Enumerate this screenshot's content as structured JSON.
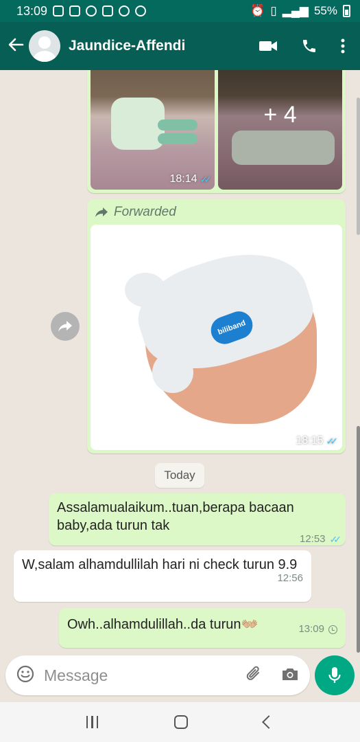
{
  "status": {
    "time": "13:09",
    "battery": "55%"
  },
  "header": {
    "contact_name": "Jaundice-Affendi",
    "back_icon": "arrow-left-icon",
    "video_icon": "video-camera-icon",
    "call_icon": "phone-icon",
    "menu_icon": "more-vert-icon"
  },
  "colors": {
    "header": "#075e54",
    "statusbar": "#056a5e",
    "outgoing": "#dcf8c6",
    "incoming": "#ffffff",
    "accent": "#00a884",
    "read_tick": "#4fc3f7"
  },
  "messages": {
    "photo_grid": {
      "more_count": "+ 4",
      "time": "18:14"
    },
    "forwarded": {
      "label": "Forwarded",
      "time": "18:15",
      "image_logo": "biliband"
    },
    "date_divider": "Today",
    "m1": {
      "text": "Assalamualaikum..tuan,berapa bacaan baby,ada turun tak",
      "time": "12:53"
    },
    "m2": {
      "text": "W,salam alhamdullilah hari ni check turun 9.9",
      "time": "12:56"
    },
    "m3": {
      "text": "Owh..alhamdulillah..da turun👐🏼",
      "time": "13:09"
    }
  },
  "composer": {
    "placeholder": "Message",
    "emoji_icon": "emoji-icon",
    "attach_icon": "paperclip-icon",
    "camera_icon": "camera-icon",
    "mic_icon": "microphone-icon"
  }
}
